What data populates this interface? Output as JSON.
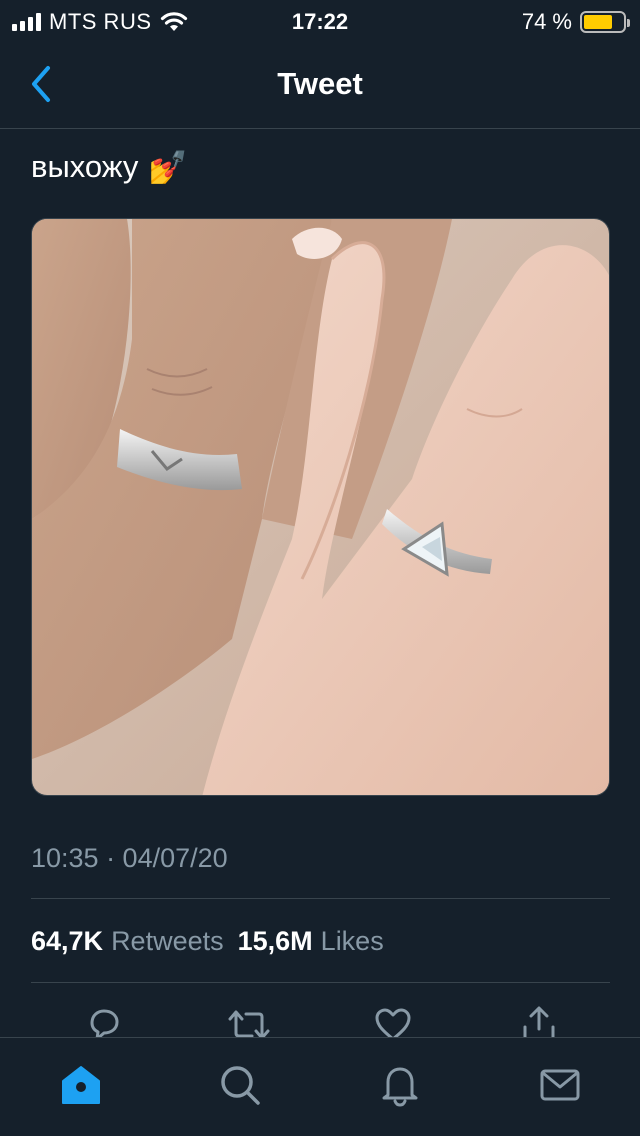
{
  "status_bar": {
    "carrier": "MTS RUS",
    "time": "17:22",
    "battery_percent": "74 %",
    "battery_level": 0.74
  },
  "nav": {
    "title": "Tweet"
  },
  "tweet": {
    "text": "выхожу",
    "emoji": "💅",
    "timestamp": "10:35 · 04/07/20",
    "retweets_count": "64,7K",
    "retweets_label": "Retweets",
    "likes_count": "15,6M",
    "likes_label": "Likes"
  },
  "colors": {
    "background": "#15202b",
    "accent": "#1da1f2",
    "secondary_text": "#8899a6",
    "divider": "#38444d",
    "battery": "#ffcc00"
  },
  "icons": {
    "back": "chevron-left-icon",
    "reply": "comment-icon",
    "retweet": "retweet-icon",
    "like": "heart-icon",
    "share": "share-icon",
    "home": "home-icon",
    "search": "search-icon",
    "notifications": "bell-icon",
    "messages": "mail-icon"
  }
}
